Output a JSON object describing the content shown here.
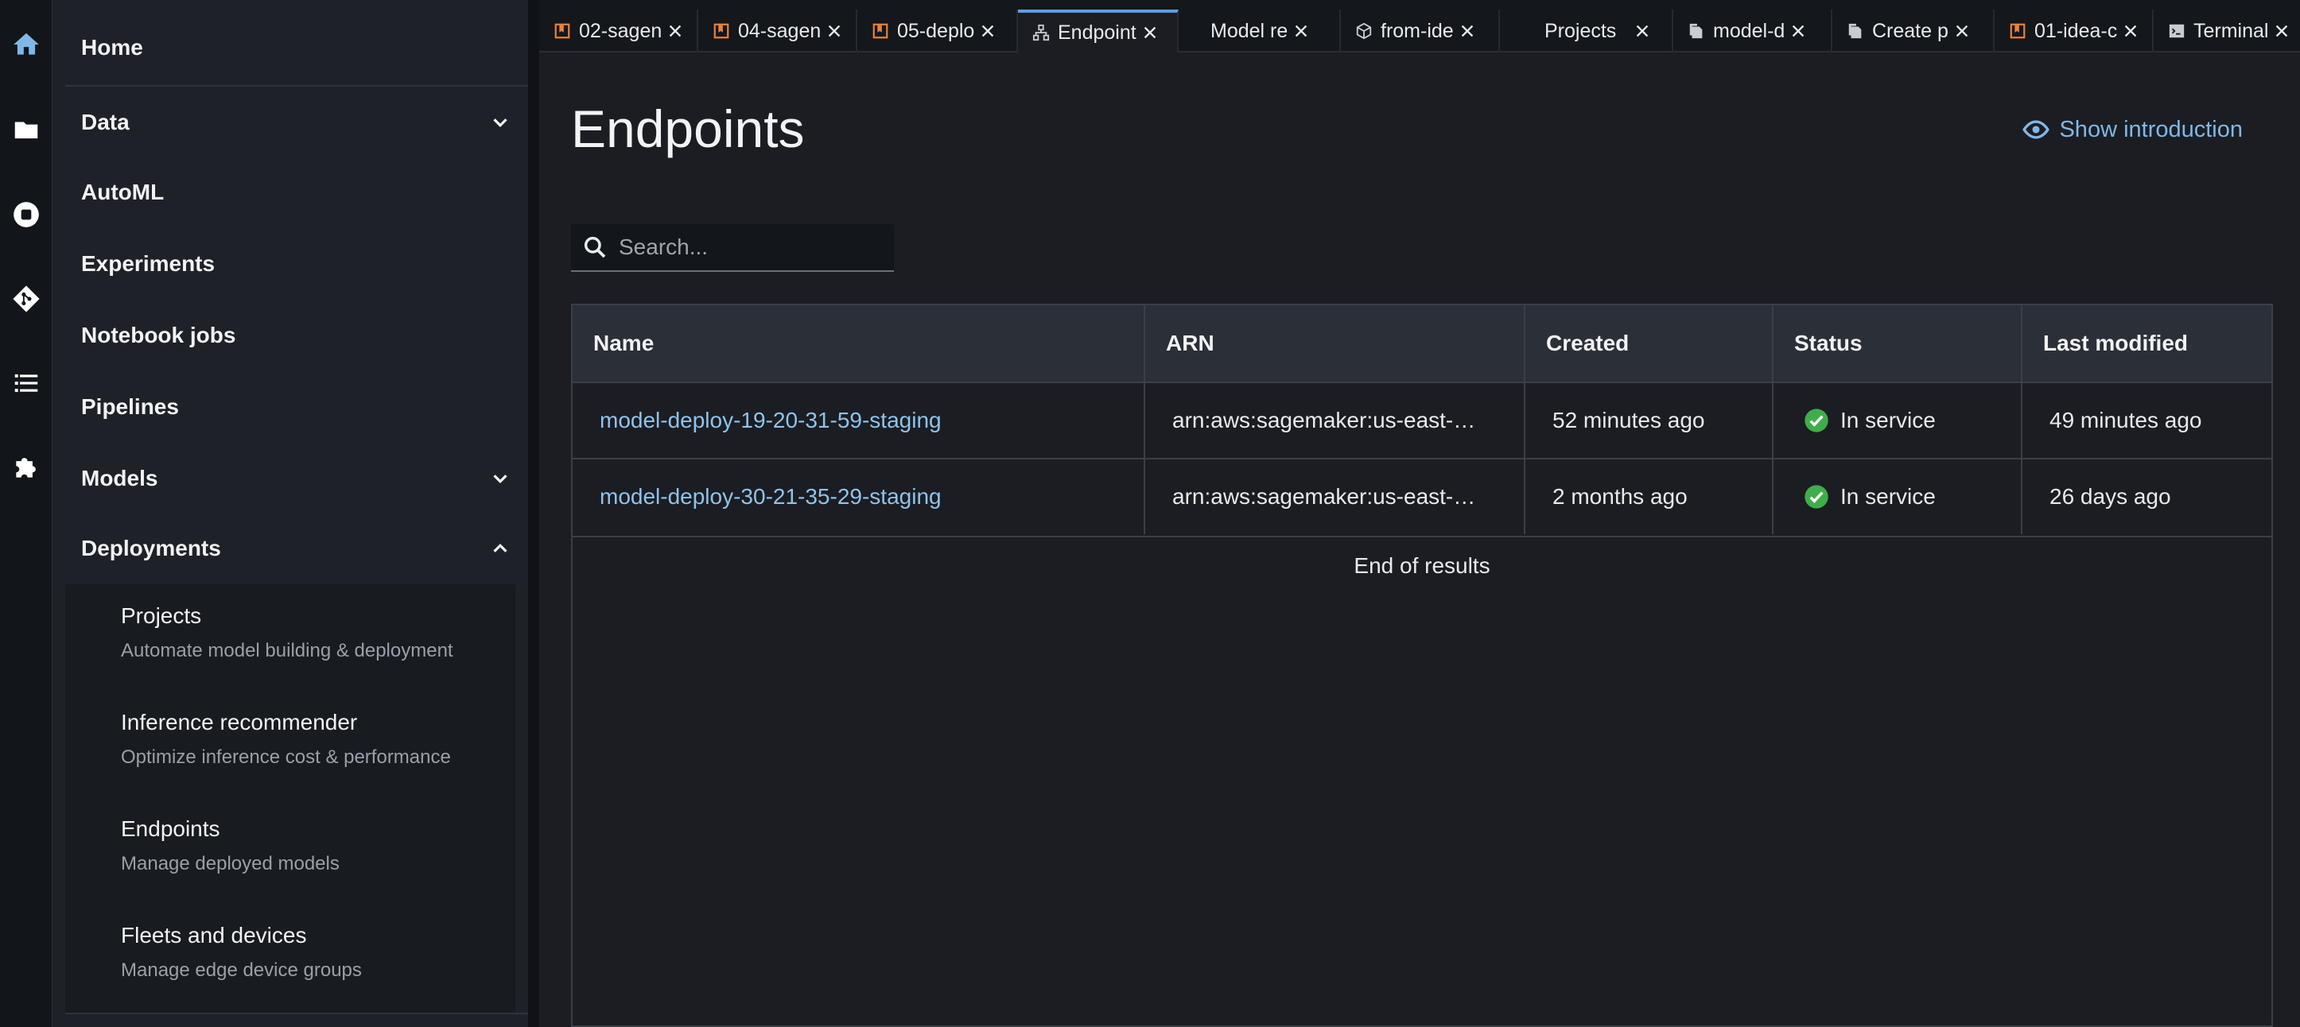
{
  "sidebar": {
    "items": [
      {
        "label": "Home"
      },
      {
        "label": "Data"
      },
      {
        "label": "AutoML"
      },
      {
        "label": "Experiments"
      },
      {
        "label": "Notebook jobs"
      },
      {
        "label": "Pipelines"
      },
      {
        "label": "Models"
      },
      {
        "label": "Deployments"
      }
    ],
    "deployments_sub": [
      {
        "title": "Projects",
        "desc": "Automate model building & deployment"
      },
      {
        "title": "Inference recommender",
        "desc": "Optimize inference cost & performance"
      },
      {
        "title": "Endpoints",
        "desc": "Manage deployed models"
      },
      {
        "title": "Fleets and devices",
        "desc": "Manage edge device groups"
      }
    ]
  },
  "tabs": [
    {
      "label": "02-sagen",
      "icon": "notebook-icon"
    },
    {
      "label": "04-sagen",
      "icon": "notebook-icon"
    },
    {
      "label": "05-deplo",
      "icon": "notebook-icon"
    },
    {
      "label": "Endpoint",
      "icon": "network-icon"
    },
    {
      "label": "Model re",
      "icon": ""
    },
    {
      "label": "from-ide",
      "icon": "cube-icon"
    },
    {
      "label": "Projects",
      "icon": ""
    },
    {
      "label": "model-d",
      "icon": "document-icon"
    },
    {
      "label": "Create p",
      "icon": "document-icon"
    },
    {
      "label": "01-idea-c",
      "icon": "notebook-icon"
    },
    {
      "label": "Terminal",
      "icon": "terminal-icon"
    }
  ],
  "main": {
    "title": "Endpoints",
    "show_intro": "Show introduction",
    "search_placeholder": "Search...",
    "table": {
      "headers": [
        "Name",
        "ARN",
        "Created",
        "Status",
        "Last modified"
      ],
      "rows": [
        [
          "model-deploy-19-20-31-59-staging",
          "arn:aws:sagemaker:us-east-…",
          "52 minutes ago",
          "In service",
          "49 minutes ago"
        ],
        [
          "model-deploy-30-21-35-29-staging",
          "arn:aws:sagemaker:us-east-…",
          "2 months ago",
          "In service",
          "26 days ago"
        ]
      ],
      "end_text": "End of results"
    }
  },
  "colors": {
    "accent": "#7fb8e8",
    "link": "#8fc3ec",
    "status_ok": "#3fae4a",
    "notebook_icon": "#e8833a"
  }
}
